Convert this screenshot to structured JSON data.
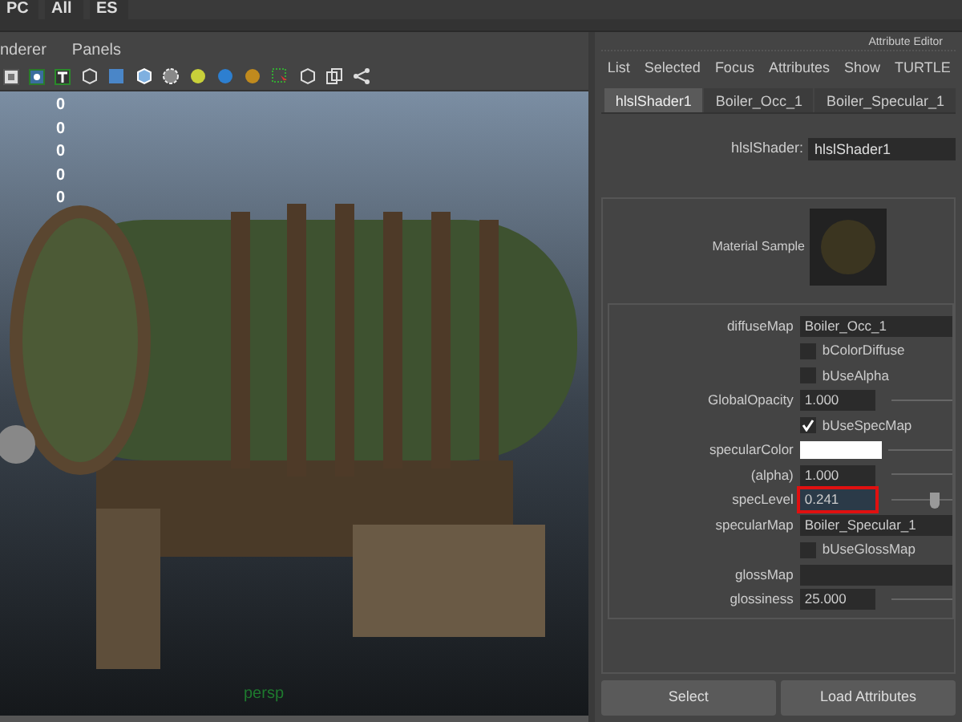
{
  "top_tabs": [
    "PC",
    "All",
    "ES"
  ],
  "viewport": {
    "menu": [
      "nderer",
      "Panels"
    ],
    "hud_values": [
      "0",
      "0",
      "0",
      "0",
      "0"
    ],
    "camera": "persp"
  },
  "attribute_editor": {
    "title": "Attribute Editor",
    "menu": [
      "List",
      "Selected",
      "Focus",
      "Attributes",
      "Show",
      "TURTLE"
    ],
    "tabs": [
      {
        "label": "hlslShader1",
        "selected": true
      },
      {
        "label": "Boiler_Occ_1",
        "selected": false
      },
      {
        "label": "Boiler_Specular_1",
        "selected": false
      }
    ],
    "shader": {
      "label": "hlslShader:",
      "value": "hlslShader1"
    },
    "material_sample": {
      "label": "Material Sample"
    },
    "attributes": [
      {
        "kind": "field",
        "label": "diffuseMap",
        "value": "Boiler_Occ_1"
      },
      {
        "kind": "checkbox",
        "label": "bColorDiffuse",
        "checked": false
      },
      {
        "kind": "checkbox",
        "label": "bUseAlpha",
        "checked": false
      },
      {
        "kind": "slider",
        "label": "GlobalOpacity",
        "value": "1.000",
        "highlighted": false
      },
      {
        "kind": "checkbox",
        "label": "bUseSpecMap",
        "checked": true
      },
      {
        "kind": "color",
        "label": "specularColor",
        "color": "#ffffff"
      },
      {
        "kind": "slider",
        "label": "(alpha)",
        "value": "1.000",
        "highlighted": false
      },
      {
        "kind": "slider",
        "label": "specLevel",
        "value": "0.241",
        "highlighted": true,
        "level": 0.75
      },
      {
        "kind": "field",
        "label": "specularMap",
        "value": "Boiler_Specular_1"
      },
      {
        "kind": "checkbox",
        "label": "bUseGlossMap",
        "checked": false
      },
      {
        "kind": "field",
        "label": "glossMap"
      },
      {
        "kind": "slider",
        "label": "glossiness",
        "value": "25.000",
        "highlighted": false
      }
    ],
    "buttons": [
      "Select",
      "Load Attributes"
    ]
  }
}
